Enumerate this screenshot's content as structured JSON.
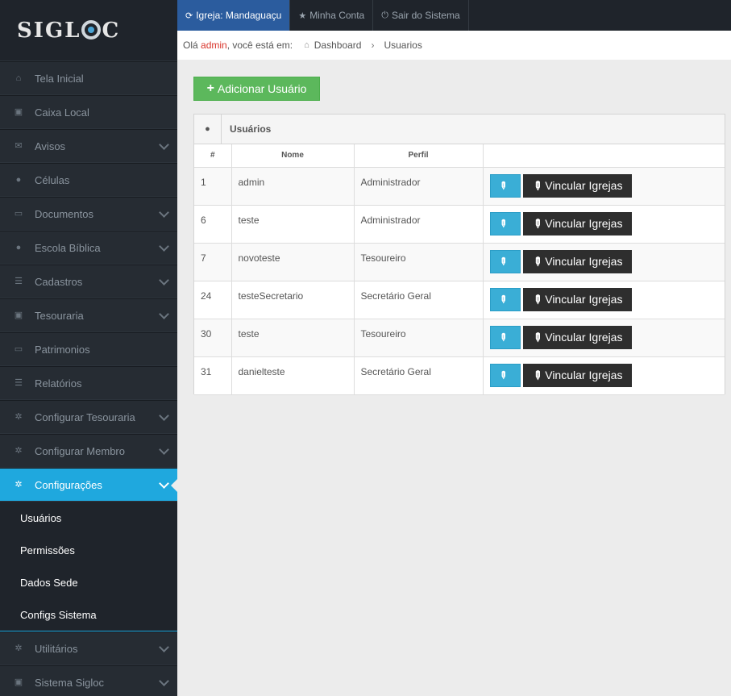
{
  "logo": {
    "part1": "SIGL",
    "part2": "C"
  },
  "topbar": {
    "church_label": "Igreja:",
    "church_name": "Mandaguaçu",
    "account": "Minha Conta",
    "logout": "Sair do Sistema"
  },
  "breadcrumb": {
    "greeting": "Olá",
    "user": "admin",
    "location_text": ", você está em:",
    "dashboard": "Dashboard",
    "current": "Usuarios"
  },
  "sidebar": {
    "items": [
      {
        "label": "Tela Inicial",
        "icon": "home-icon",
        "chev": false
      },
      {
        "label": "Caixa Local",
        "icon": "money-icon",
        "chev": false
      },
      {
        "label": "Avisos",
        "icon": "envelope-icon",
        "chev": true
      },
      {
        "label": "Células",
        "icon": "users-icon",
        "chev": false
      },
      {
        "label": "Documentos",
        "icon": "inbox-icon",
        "chev": true
      },
      {
        "label": "Escola Bíblica",
        "icon": "users-icon",
        "chev": true
      },
      {
        "label": "Cadastros",
        "icon": "list-icon",
        "chev": true
      },
      {
        "label": "Tesouraria",
        "icon": "money-icon",
        "chev": true
      },
      {
        "label": "Patrimonios",
        "icon": "inbox-icon",
        "chev": false
      },
      {
        "label": "Relatórios",
        "icon": "list-icon",
        "chev": false
      },
      {
        "label": "Configurar Tesouraria",
        "icon": "gear-icon",
        "chev": true
      },
      {
        "label": "Configurar Membro",
        "icon": "gear-icon",
        "chev": true
      },
      {
        "label": "Configurações",
        "icon": "gear-icon",
        "chev": true
      }
    ],
    "subitems": [
      "Usuários",
      "Permissões",
      "Dados Sede",
      "Configs Sistema"
    ],
    "bottom": [
      {
        "label": "Utilitários",
        "icon": "gear-icon"
      },
      {
        "label": "Sistema Sigloc",
        "icon": "money-icon"
      }
    ]
  },
  "add_button": "Adicionar Usuário",
  "panel": {
    "title": "Usuários",
    "columns": [
      "#",
      "Nome",
      "Perfil",
      ""
    ],
    "link_label": "Vincular Igrejas",
    "rows": [
      {
        "id": "1",
        "name": "admin",
        "profile": "Administrador"
      },
      {
        "id": "6",
        "name": "teste",
        "profile": "Administrador"
      },
      {
        "id": "7",
        "name": "novoteste",
        "profile": "Tesoureiro"
      },
      {
        "id": "24",
        "name": "testeSecretario",
        "profile": "Secretário Geral"
      },
      {
        "id": "30",
        "name": "teste",
        "profile": "Tesoureiro"
      },
      {
        "id": "31",
        "name": "danielteste",
        "profile": "Secretário Geral"
      }
    ]
  }
}
